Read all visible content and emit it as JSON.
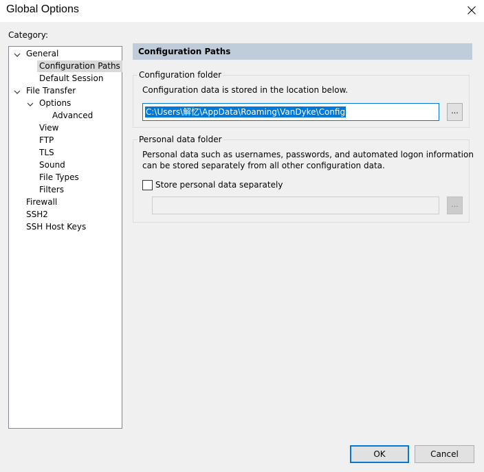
{
  "window": {
    "title": "Global Options"
  },
  "category_label": "Category:",
  "tree": {
    "general": "General",
    "configuration_paths": "Configuration Paths",
    "default_session": "Default Session",
    "file_transfer": "File Transfer",
    "options": "Options",
    "advanced": "Advanced",
    "view": "View",
    "ftp": "FTP",
    "tls": "TLS",
    "sound": "Sound",
    "file_types": "File Types",
    "filters": "Filters",
    "firewall": "Firewall",
    "ssh2": "SSH2",
    "ssh_host_keys": "SSH Host Keys"
  },
  "panel": {
    "header": "Configuration Paths",
    "config_group": {
      "title": "Configuration folder",
      "description": "Configuration data is stored in the location below.",
      "path_value": "C:\\Users\\解忆\\AppData\\Roaming\\VanDyke\\Config",
      "browse_label": "..."
    },
    "personal_group": {
      "title": "Personal data folder",
      "description_line1": "Personal data such as usernames, passwords, and automated logon information",
      "description_line2": "can be stored separately from all other configuration data.",
      "checkbox_label": "Store personal data separately",
      "checkbox_checked": false,
      "browse_label": "..."
    }
  },
  "buttons": {
    "ok": "OK",
    "cancel": "Cancel"
  },
  "colors": {
    "accent": "#0078d7",
    "header_bg": "#bfcddb",
    "selection": "#d9d9d9"
  }
}
